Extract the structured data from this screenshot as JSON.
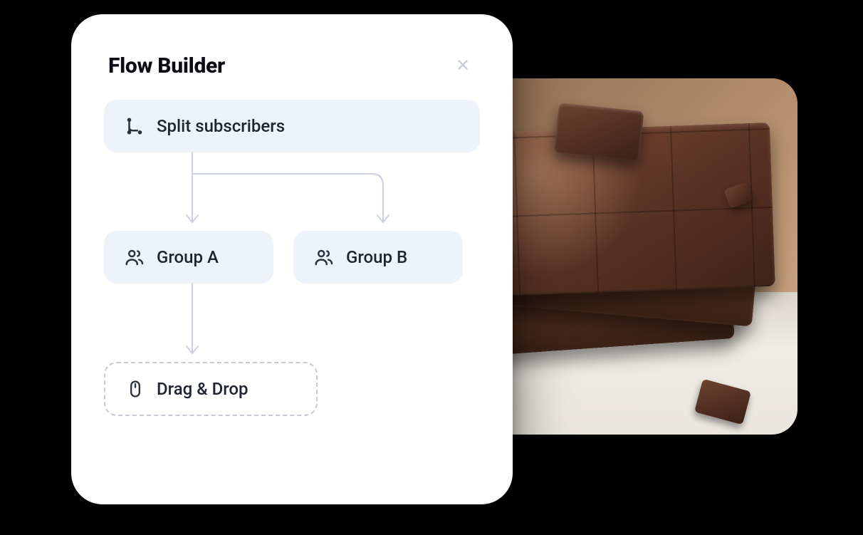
{
  "panel": {
    "title": "Flow Builder",
    "close_icon": "close-icon"
  },
  "nodes": {
    "root": {
      "label": "Split subscribers",
      "icon": "branch-icon"
    },
    "group_a": {
      "label": "Group A",
      "icon": "users-icon"
    },
    "group_b": {
      "label": "Group B",
      "icon": "users-icon"
    },
    "dropzone": {
      "label": "Drag & Drop",
      "icon": "mouse-icon"
    }
  },
  "photo": {
    "alt": "Stack of chocolate bars"
  },
  "colors": {
    "node_bg": "#eef2fb",
    "connector": "#cfd3df",
    "text": "#1f2430"
  }
}
